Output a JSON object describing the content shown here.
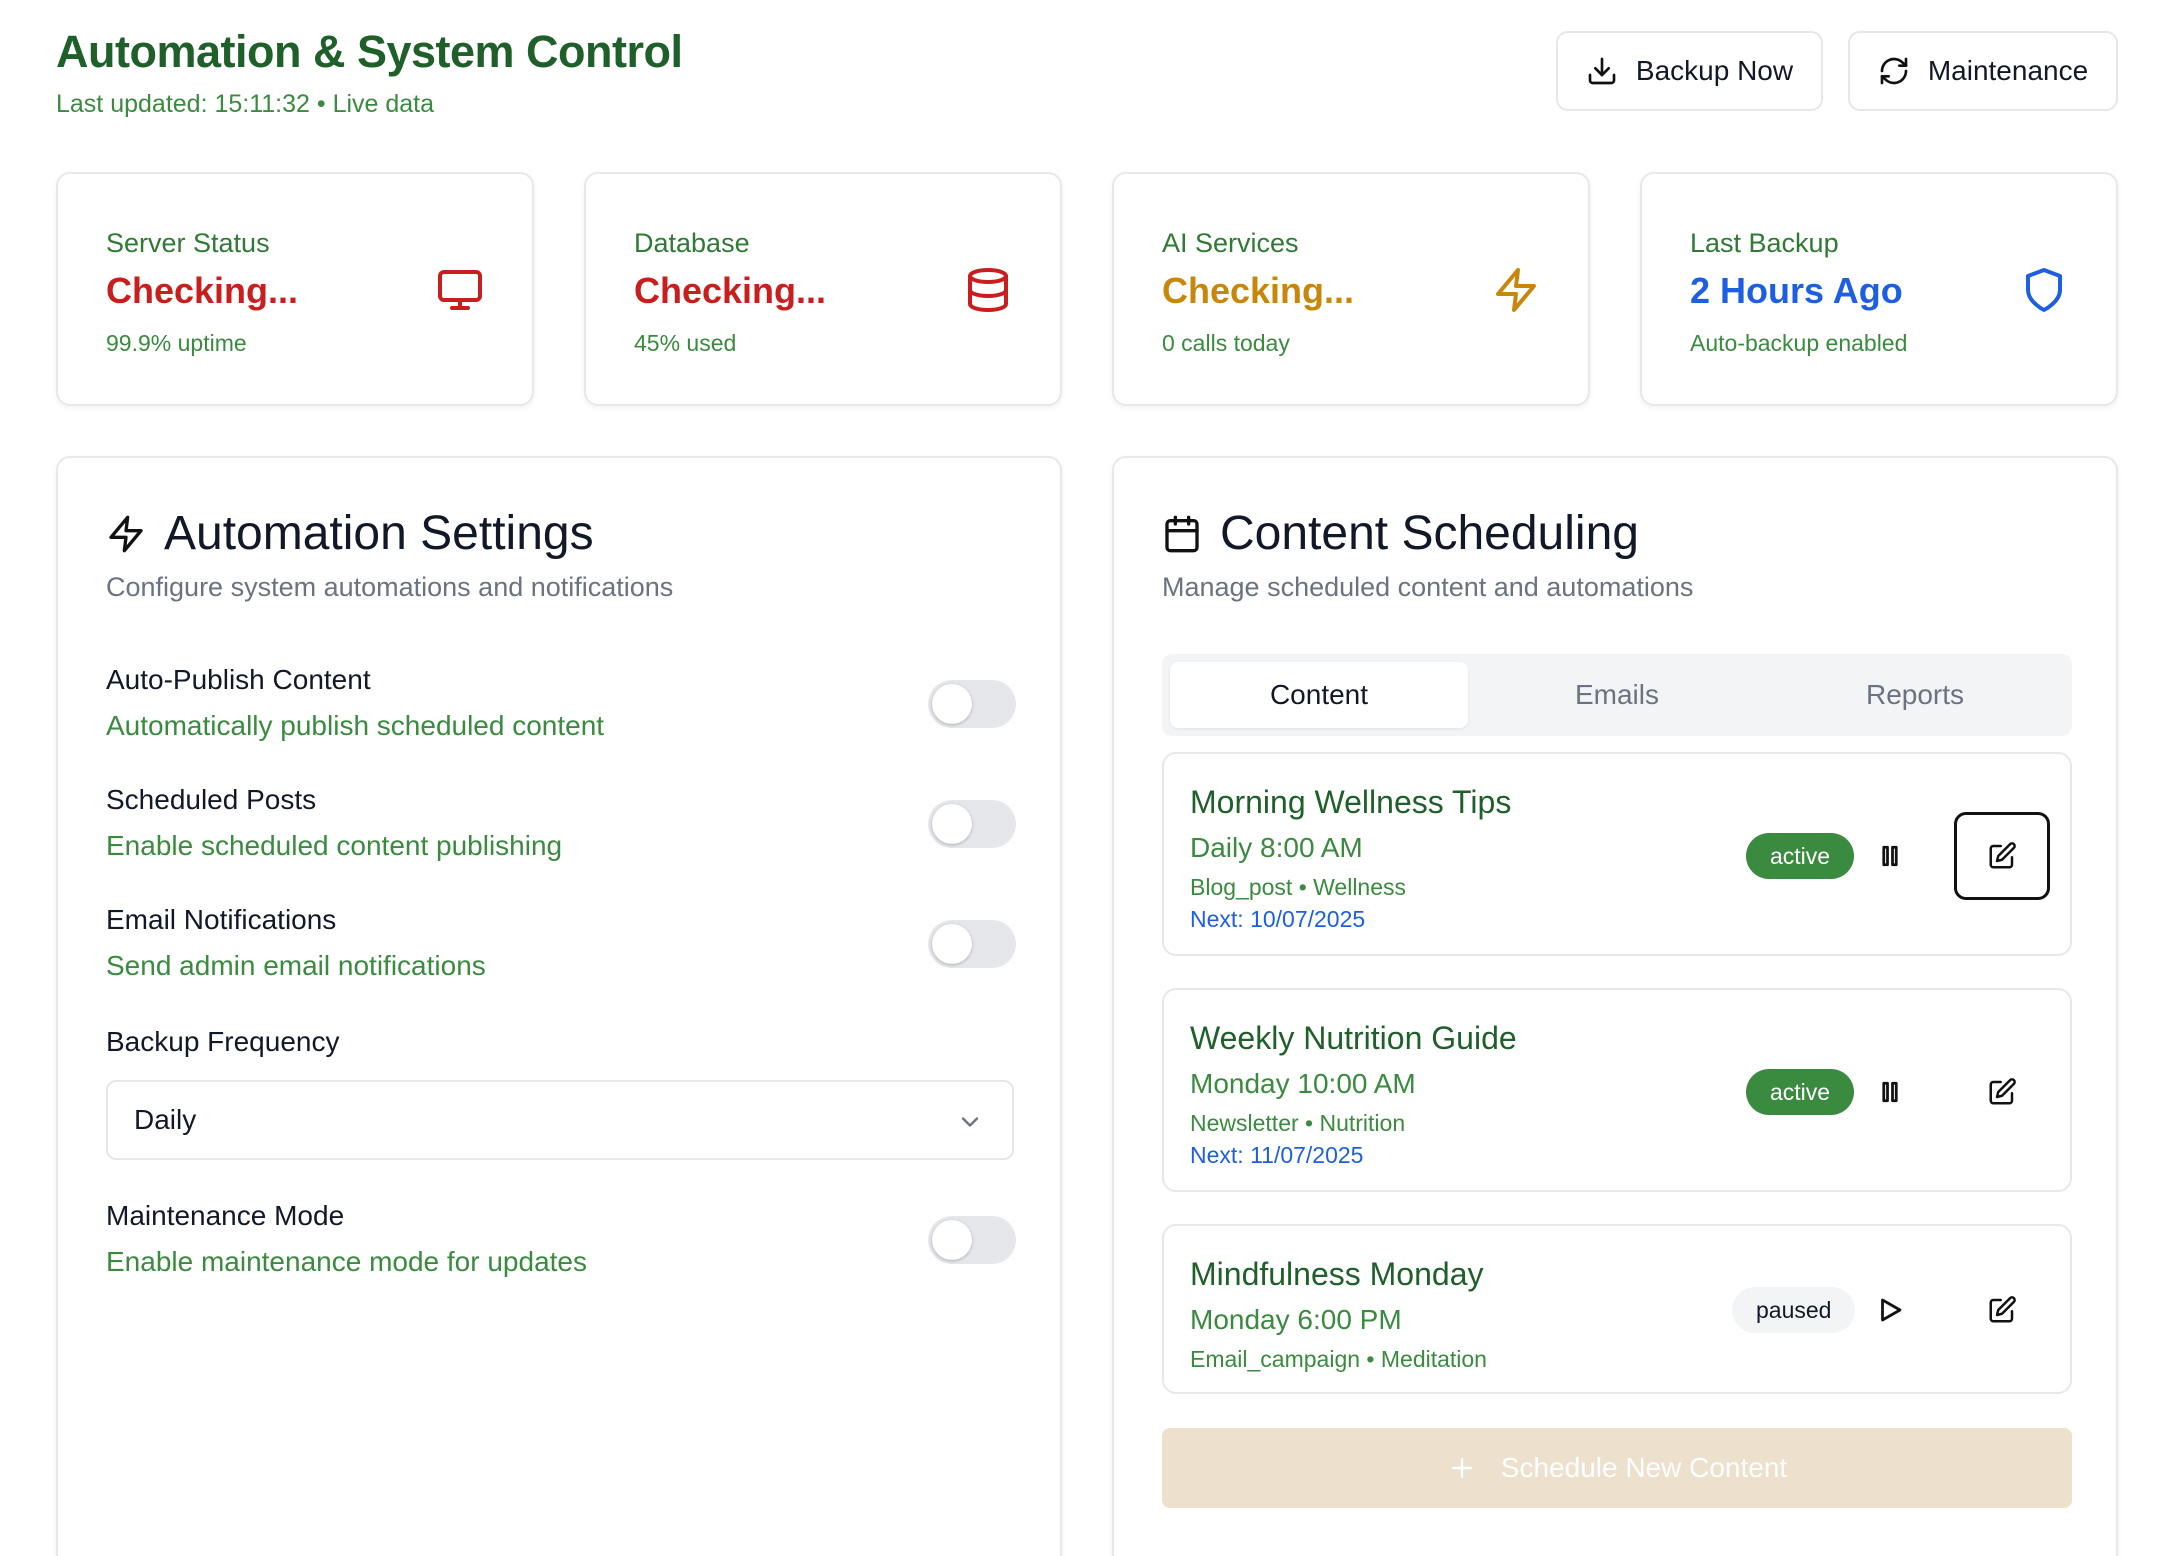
{
  "header": {
    "title": "Automation & System Control",
    "subtitle": "Last updated: 15:11:32 • Live data",
    "backup_button": "Backup Now",
    "maintenance_button": "Maintenance"
  },
  "stats": [
    {
      "label": "Server Status",
      "value": "Checking...",
      "sub": "99.9% uptime",
      "icon": "monitor-icon",
      "color": "#c81e1e"
    },
    {
      "label": "Database",
      "value": "Checking...",
      "sub": "45% used",
      "icon": "database-icon",
      "color": "#c81e1e"
    },
    {
      "label": "AI Services",
      "value": "Checking...",
      "sub": "0 calls today",
      "icon": "lightning-icon",
      "color": "#c8870a"
    },
    {
      "label": "Last Backup",
      "value": "2 Hours Ago",
      "sub": "Auto-backup enabled",
      "icon": "shield-icon",
      "color": "#1d5fe0"
    }
  ],
  "automation": {
    "title": "Automation Settings",
    "description": "Configure system automations and notifications",
    "settings": [
      {
        "title": "Auto-Publish Content",
        "description": "Automatically publish scheduled content",
        "enabled": false
      },
      {
        "title": "Scheduled Posts",
        "description": "Enable scheduled content publishing",
        "enabled": false
      },
      {
        "title": "Email Notifications",
        "description": "Send admin email notifications",
        "enabled": false
      }
    ],
    "backup_frequency_label": "Backup Frequency",
    "backup_frequency_value": "Daily",
    "maintenance": {
      "title": "Maintenance Mode",
      "description": "Enable maintenance mode for updates",
      "enabled": false
    }
  },
  "scheduling": {
    "title": "Content Scheduling",
    "description": "Manage scheduled content and automations",
    "tabs": [
      {
        "label": "Content"
      },
      {
        "label": "Emails"
      },
      {
        "label": "Reports"
      }
    ],
    "items": [
      {
        "title": "Morning Wellness Tips",
        "schedule": "Daily 8:00 AM",
        "meta": "Blog_post • Wellness",
        "next": "Next: 10/07/2025",
        "status": "active"
      },
      {
        "title": "Weekly Nutrition Guide",
        "schedule": "Monday 10:00 AM",
        "meta": "Newsletter • Nutrition",
        "next": "Next: 11/07/2025",
        "status": "active"
      },
      {
        "title": "Mindfulness Monday",
        "schedule": "Monday 6:00 PM",
        "meta": "Email_campaign • Meditation",
        "status": "paused"
      }
    ],
    "add_button": "Schedule New Content"
  }
}
